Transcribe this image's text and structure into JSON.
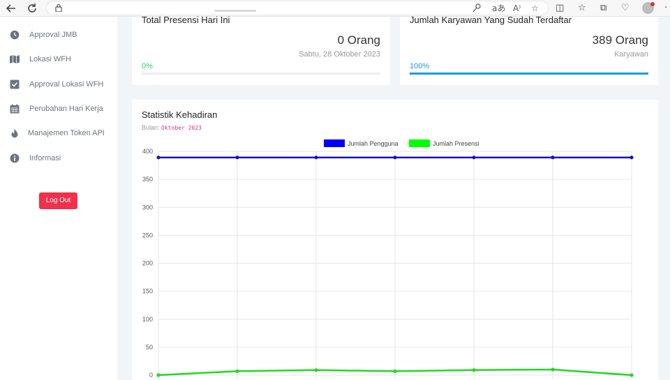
{
  "browser": {
    "reader_icon": "Aᵃ",
    "read_aloud_icon": "A⁾"
  },
  "sidebar": {
    "items": [
      {
        "label": "Approval JMB",
        "icon": "clock-icon"
      },
      {
        "label": "Lokasi WFH",
        "icon": "map-icon"
      },
      {
        "label": "Approval Lokasi WFH",
        "icon": "check-square-icon"
      },
      {
        "label": "Perubahan Hari Kerja",
        "icon": "calendar-icon"
      },
      {
        "label": "Manajemen Token API",
        "icon": "fire-icon"
      },
      {
        "label": "Informasi",
        "icon": "info-icon"
      }
    ],
    "logout_label": "Log Out"
  },
  "cards": {
    "presensi": {
      "title": "Total Presensi Hari Ini",
      "value": "0 Orang",
      "sub": "Sabtu, 28 Oktober 2023",
      "percent_label": "0%",
      "progress": 0,
      "color": "#2ecc71"
    },
    "karyawan": {
      "title": "Jumlah Karyawan Yang Sudah Terdaftar",
      "value": "389 Orang",
      "sub": "Karyawan",
      "percent_label": "100%",
      "progress": 1,
      "color": "#1e9be0"
    }
  },
  "statistik": {
    "title": "Statistik Kehadiran",
    "month_prefix": "Bulan:",
    "month": "Oktober 2023"
  },
  "chart_data": {
    "type": "line",
    "title": "",
    "xlabel": "",
    "ylabel": "",
    "x": [
      1,
      2,
      3,
      4,
      5,
      6,
      7
    ],
    "ylim": [
      0,
      400
    ],
    "yticks": [
      0,
      50,
      100,
      150,
      200,
      250,
      300,
      350,
      400
    ],
    "grid": true,
    "legend": "top",
    "series": [
      {
        "name": "Jumlah Pengguna",
        "color": "#1414b8",
        "legend_color": "#0000ff",
        "values": [
          389,
          389,
          389,
          389,
          389,
          389,
          389
        ]
      },
      {
        "name": "Jumlah Presensi",
        "color": "#22d822",
        "legend_color": "#00ff00",
        "values": [
          0,
          7,
          9,
          7,
          9,
          10,
          0
        ]
      }
    ]
  }
}
